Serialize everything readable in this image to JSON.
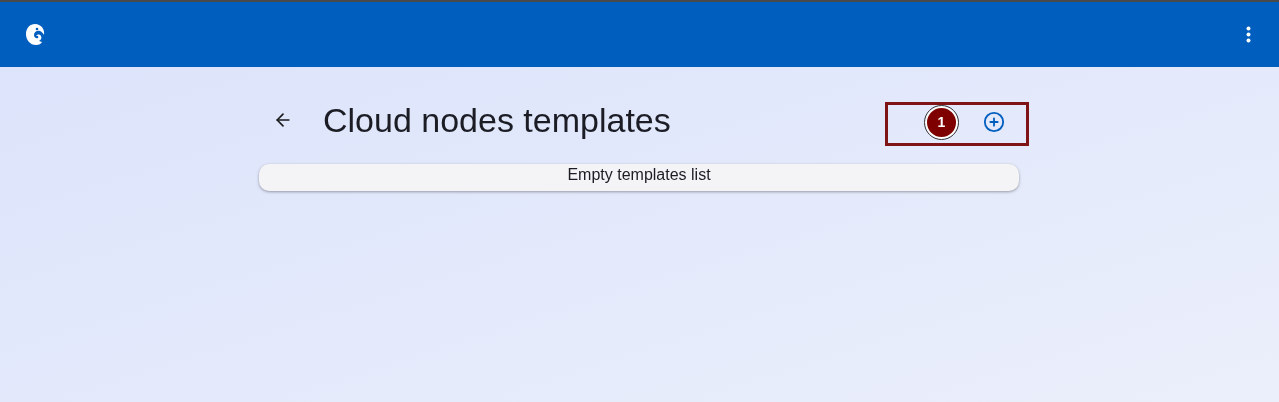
{
  "page": {
    "title": "Cloud nodes templates"
  },
  "annotation": {
    "badge": "1"
  },
  "templates": {
    "empty_message": "Empty templates list"
  }
}
